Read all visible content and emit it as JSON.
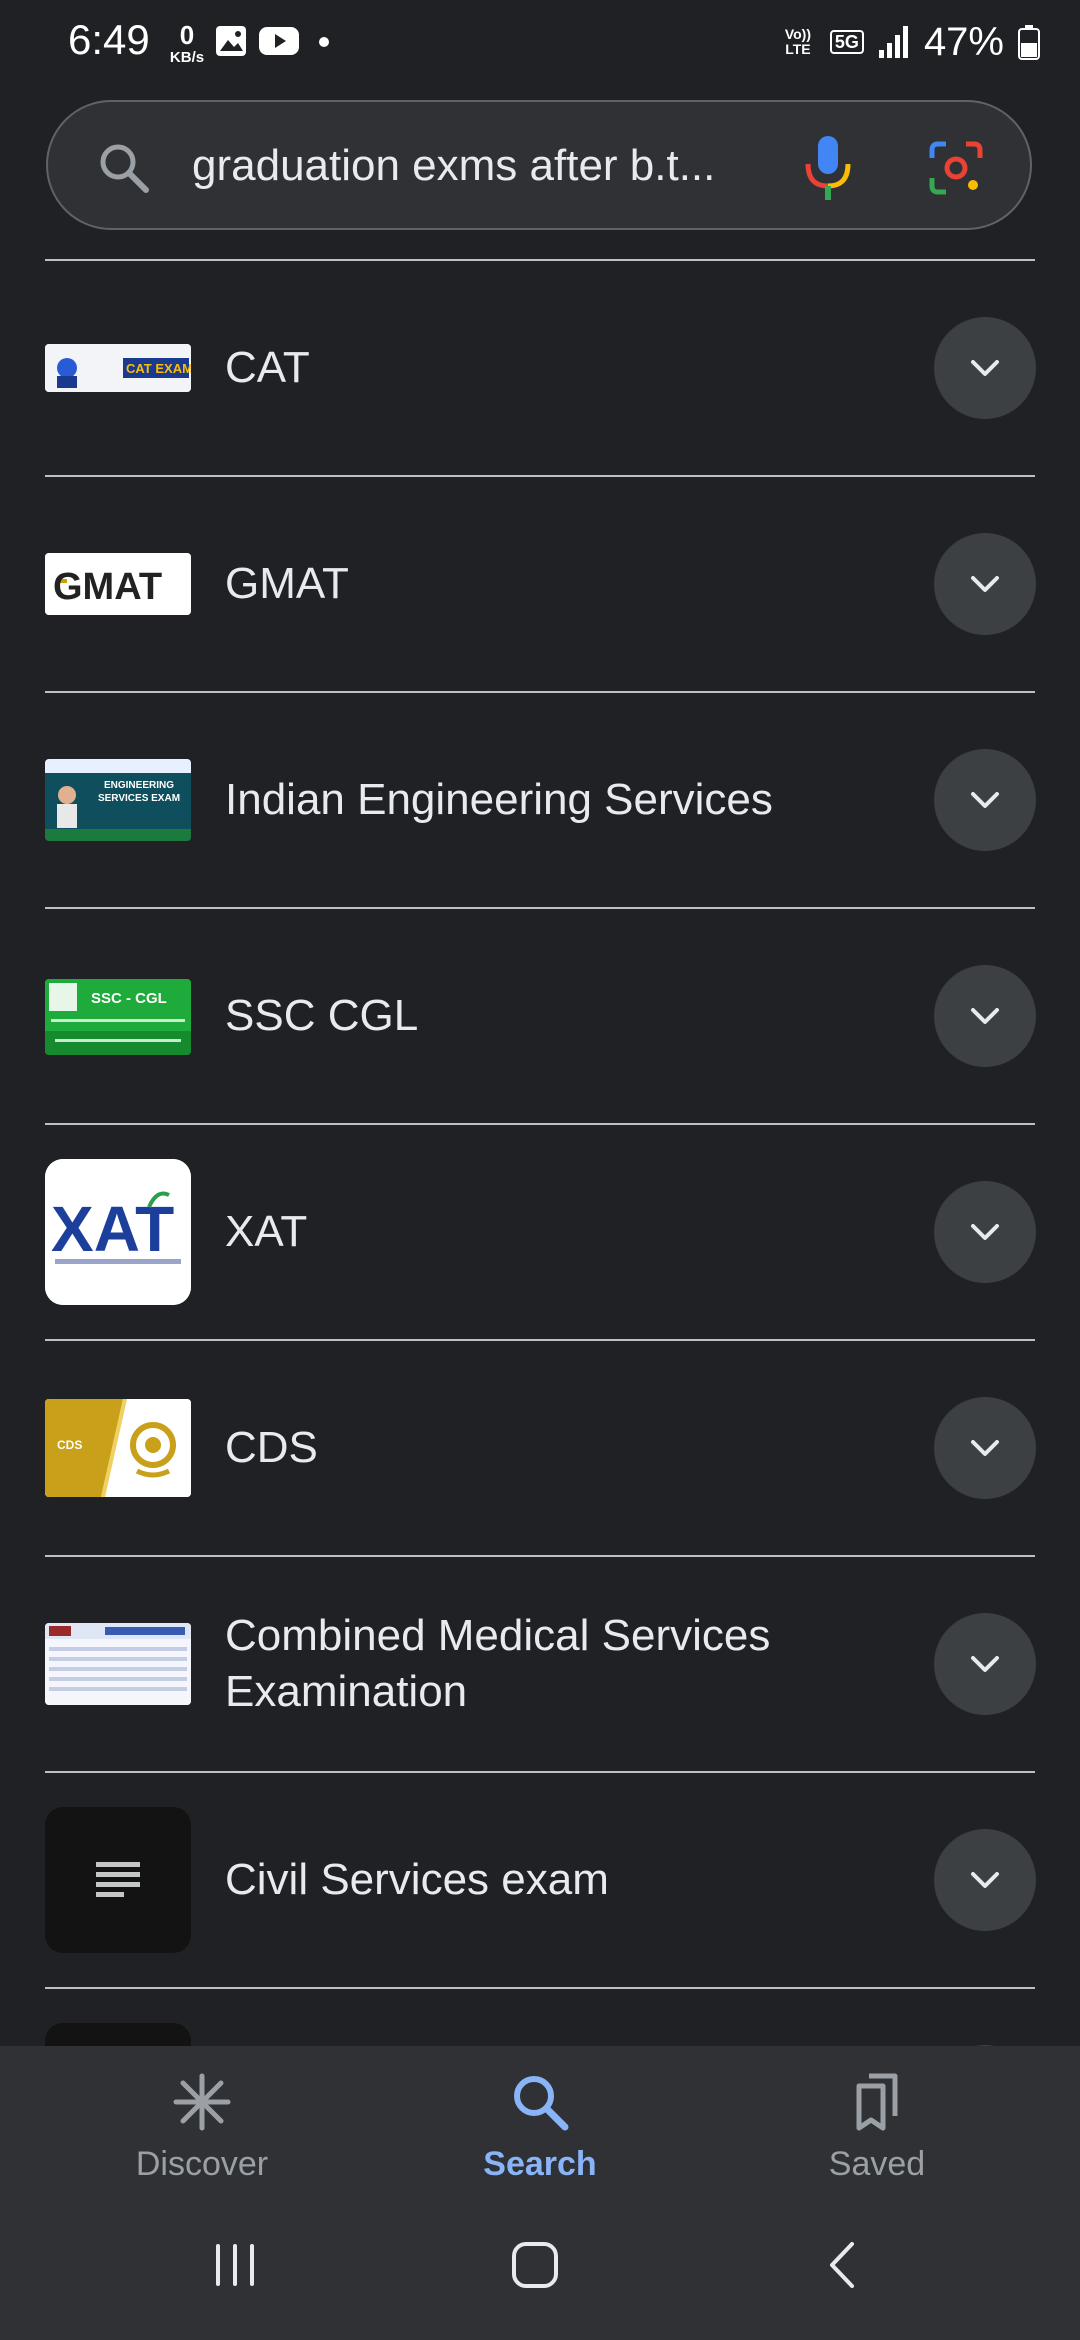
{
  "status": {
    "time": "6:49",
    "data_rate_value": "0",
    "data_rate_unit": "KB/s",
    "network_volte": "Vo)) LTE",
    "network_5g": "5G",
    "battery": "47%",
    "icons": [
      "gallery-icon",
      "youtube-icon",
      "dot-icon",
      "signal-icon",
      "battery-icon"
    ]
  },
  "search": {
    "query": "graduation exms after b.t...",
    "icons": [
      "search-icon",
      "mic-icon",
      "lens-icon"
    ]
  },
  "results": [
    {
      "label": "CAT",
      "thumb_text": "CAT EXAM"
    },
    {
      "label": "GMAT",
      "thumb_text": "GMAT"
    },
    {
      "label": "Indian Engineering Services",
      "thumb_text": "ENGINEERING SERVICES EXAM"
    },
    {
      "label": "SSC CGL",
      "thumb_text": "SSC - CGL"
    },
    {
      "label": "XAT",
      "thumb_text": "XAT"
    },
    {
      "label": "CDS",
      "thumb_text": "CDS"
    },
    {
      "label": "Combined Medical Services Examination",
      "thumb_text": ""
    },
    {
      "label": "Civil Services exam",
      "thumb_text": ""
    }
  ],
  "nav": {
    "discover": "Discover",
    "search": "Search",
    "saved": "Saved",
    "active": "search"
  },
  "colors": {
    "background": "#202124",
    "surface": "#303134",
    "accent": "#8ab4f8",
    "text": "#e8eaed",
    "muted": "#9aa0a6"
  }
}
